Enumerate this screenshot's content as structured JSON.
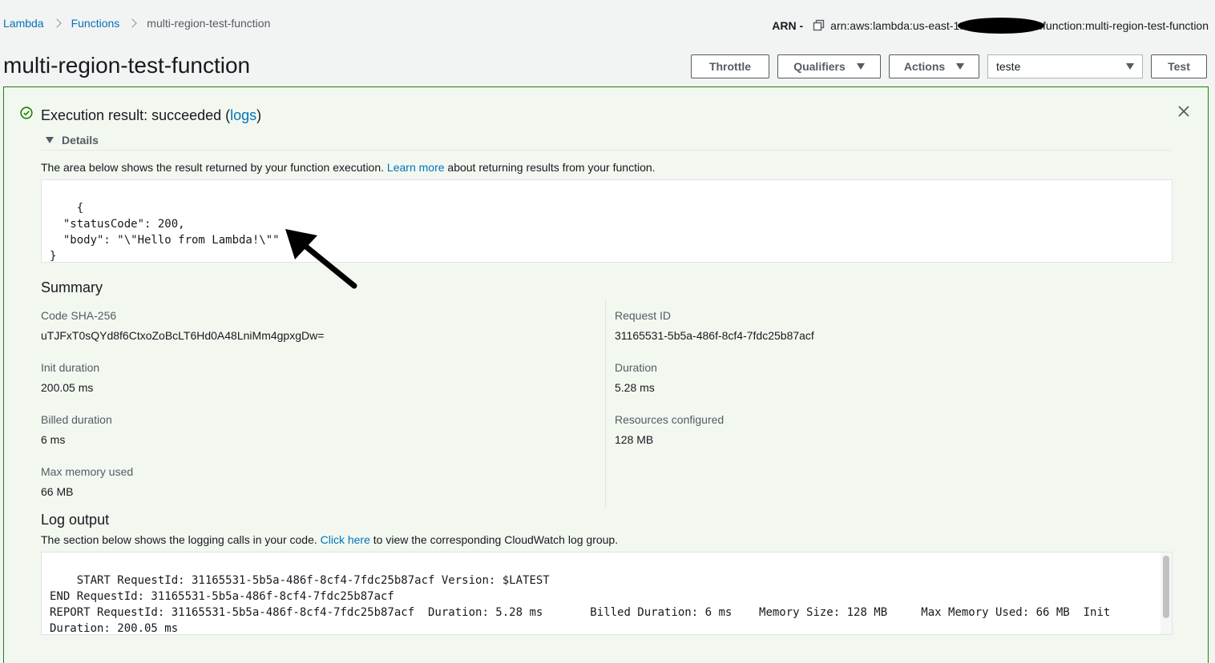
{
  "breadcrumb": {
    "items": [
      "Lambda",
      "Functions"
    ],
    "current": "multi-region-test-function"
  },
  "arn": {
    "label": "ARN -",
    "prefix": "arn:aws:lambda:us-east-1:",
    "suffix": ":function:multi-region-test-function"
  },
  "page_title": "multi-region-test-function",
  "toolbar": {
    "throttle_label": "Throttle",
    "qualifiers_label": "Qualifiers",
    "actions_label": "Actions",
    "test_event_selected": "teste",
    "test_label": "Test"
  },
  "result": {
    "title_prefix": "Execution result: succeeded (",
    "logs_link": "logs",
    "title_suffix": ")",
    "details_label": "Details",
    "desc_prefix": "The area below shows the result returned by your function execution. ",
    "learn_more": "Learn more",
    "desc_suffix": " about returning results from your function.",
    "output": "{\n  \"statusCode\": 200,\n  \"body\": \"\\\"Hello from Lambda!\\\"\"\n}"
  },
  "summary": {
    "title": "Summary",
    "left": [
      {
        "label": "Code SHA-256",
        "value": "uTJFxT0sQYd8f6CtxoZoBcLT6Hd0A48LniMm4gpxgDw="
      },
      {
        "label": "Init duration",
        "value": "200.05 ms"
      },
      {
        "label": "Billed duration",
        "value": "6 ms"
      },
      {
        "label": "Max memory used",
        "value": "66 MB"
      }
    ],
    "right": [
      {
        "label": "Request ID",
        "value": "31165531-5b5a-486f-8cf4-7fdc25b87acf"
      },
      {
        "label": "Duration",
        "value": "5.28 ms"
      },
      {
        "label": "Resources configured",
        "value": "128 MB"
      }
    ]
  },
  "log_output": {
    "title": "Log output",
    "desc_prefix": "The section below shows the logging calls in your code. ",
    "click_here": "Click here",
    "desc_suffix": " to view the corresponding CloudWatch log group.",
    "text": "START RequestId: 31165531-5b5a-486f-8cf4-7fdc25b87acf Version: $LATEST\nEND RequestId: 31165531-5b5a-486f-8cf4-7fdc25b87acf\nREPORT RequestId: 31165531-5b5a-486f-8cf4-7fdc25b87acf  Duration: 5.28 ms       Billed Duration: 6 ms    Memory Size: 128 MB     Max Memory Used: 66 MB  Init\nDuration: 200.05 ms"
  },
  "colors": {
    "link": "#0073bb",
    "success": "#1d8102",
    "panel_bg": "#f2f8f0"
  }
}
